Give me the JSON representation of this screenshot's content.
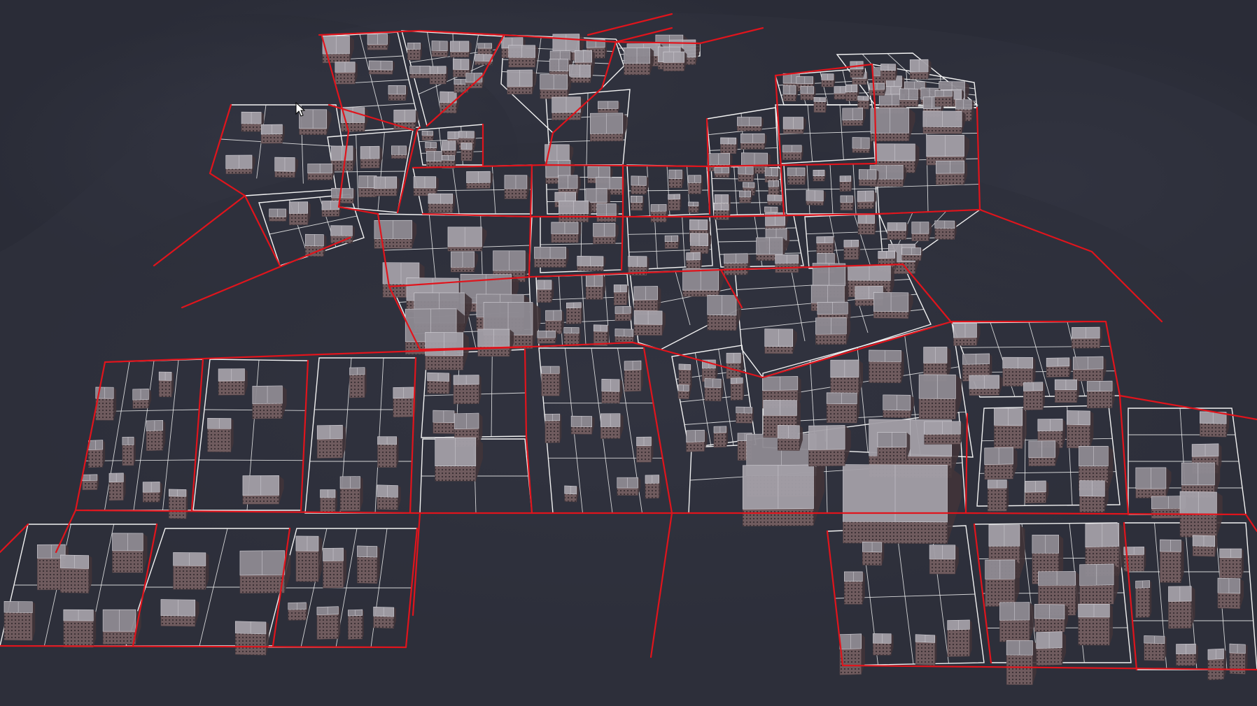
{
  "scene": {
    "view": "3d-viewport",
    "content": "procedural-city-layout",
    "colors": {
      "background": "#2a2c37",
      "terrain": "#30323e",
      "terrain_highlight": "#3a3c4a",
      "road": "#e0141c",
      "lot_outline": "#f2f2f2",
      "building_roof": "#8e8a92",
      "building_roof_light": "#a39fa7",
      "building_wall": "#6e5a5c",
      "building_window": "#413438"
    },
    "cursor": {
      "icon": "mouse-pointer-icon"
    }
  }
}
